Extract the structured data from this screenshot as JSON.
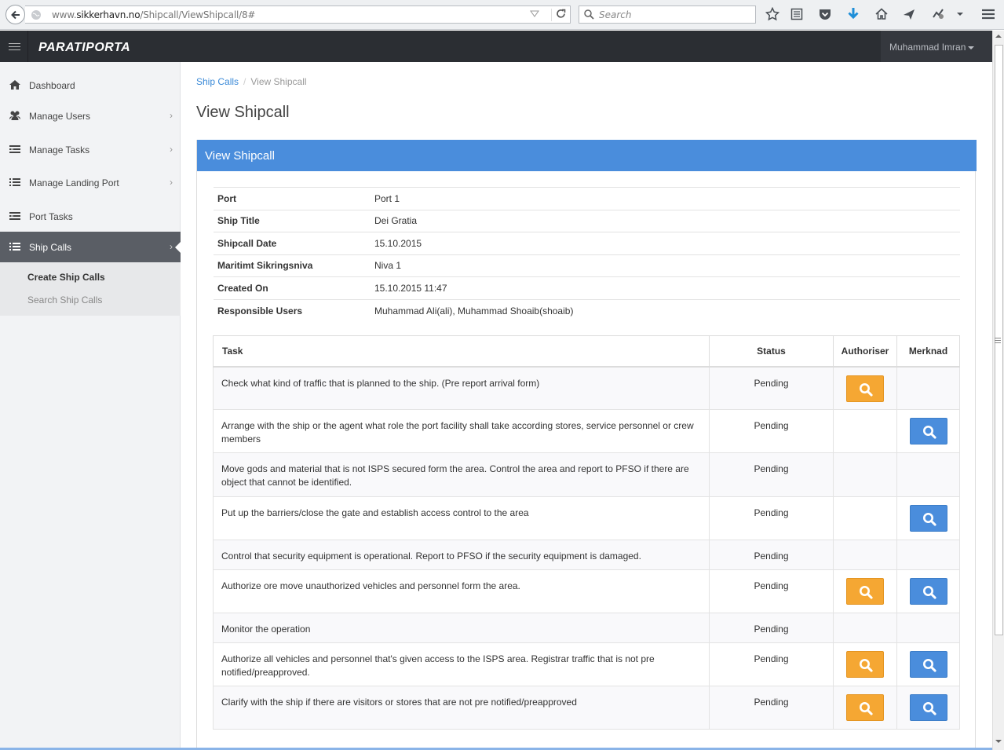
{
  "browser": {
    "url_prefix": "www.",
    "url_domain": "sikkerhavn.no",
    "url_path": "/Shipcall/ViewShipcall/8#",
    "search_placeholder": "Search"
  },
  "navbar": {
    "brand": "PARATIPORTA",
    "user_name": "Muhammad Imran"
  },
  "sidebar": {
    "items": [
      {
        "label": "Dashboard",
        "icon": "home-icon",
        "has_children": false
      },
      {
        "label": "Manage Users",
        "icon": "users-icon",
        "has_children": true
      },
      {
        "label": "Manage Tasks",
        "icon": "tasks-icon",
        "has_children": true
      },
      {
        "label": "Manage Landing Port",
        "icon": "list-icon",
        "has_children": true
      },
      {
        "label": "Port Tasks",
        "icon": "tasks-icon",
        "has_children": false
      },
      {
        "label": "Ship Calls",
        "icon": "list-icon",
        "has_children": true,
        "active": true
      }
    ],
    "submenu": [
      {
        "label": "Create Ship Calls",
        "active": true
      },
      {
        "label": "Search Ship Calls",
        "active": false
      }
    ]
  },
  "breadcrumb": {
    "parent": "Ship Calls",
    "current": "View Shipcall"
  },
  "page_title": "View Shipcall",
  "panel_title": "View Shipcall",
  "details": [
    {
      "label": "Port",
      "value": "Port 1"
    },
    {
      "label": "Ship Title",
      "value": "Dei Gratia"
    },
    {
      "label": "Shipcall Date",
      "value": "15.10.2015"
    },
    {
      "label": "Maritimt Sikringsniva",
      "value": "Niva 1"
    },
    {
      "label": "Created On",
      "value": "15.10.2015 11:47"
    },
    {
      "label": "Responsible Users",
      "value": "Muhammad Ali(ali), Muhammad Shoaib(shoaib)"
    }
  ],
  "task_table": {
    "headers": {
      "task": "Task",
      "status": "Status",
      "authoriser": "Authoriser",
      "merknad": "Merknad"
    },
    "rows": [
      {
        "task": "Check what kind of traffic that is planned to the ship. (Pre report arrival form)",
        "status": "Pending",
        "authoriser": true,
        "merknad": false
      },
      {
        "task": "Arrange with the ship or the agent what role the port facility shall take according stores, service personnel or crew members",
        "status": "Pending",
        "authoriser": false,
        "merknad": true
      },
      {
        "task": "Move gods and material that is not ISPS secured form the area. Control the area and report to PFSO if there are object that cannot be identified.",
        "status": "Pending",
        "authoriser": false,
        "merknad": false
      },
      {
        "task": "Put up the barriers/close the gate and establish access control to the area",
        "status": "Pending",
        "authoriser": false,
        "merknad": true
      },
      {
        "task": "Control that security equipment is operational. Report to PFSO if the security equipment is damaged.",
        "status": "Pending",
        "authoriser": false,
        "merknad": false
      },
      {
        "task": "Authorize ore move unauthorized vehicles and personnel form the area.",
        "status": "Pending",
        "authoriser": true,
        "merknad": true
      },
      {
        "task": "Monitor the operation",
        "status": "Pending",
        "authoriser": false,
        "merknad": false
      },
      {
        "task": "Authorize all vehicles and personnel that's given access to the ISPS area. Registrar traffic that is not pre notified/preapproved.",
        "status": "Pending",
        "authoriser": true,
        "merknad": true
      },
      {
        "task": "Clarify with the ship if there are visitors or stores that are not pre notified/preapproved",
        "status": "Pending",
        "authoriser": true,
        "merknad": true
      }
    ]
  },
  "colors": {
    "accent_blue": "#4a8ddc",
    "button_orange": "#f5a733",
    "navbar_dark": "#2b2e33"
  }
}
